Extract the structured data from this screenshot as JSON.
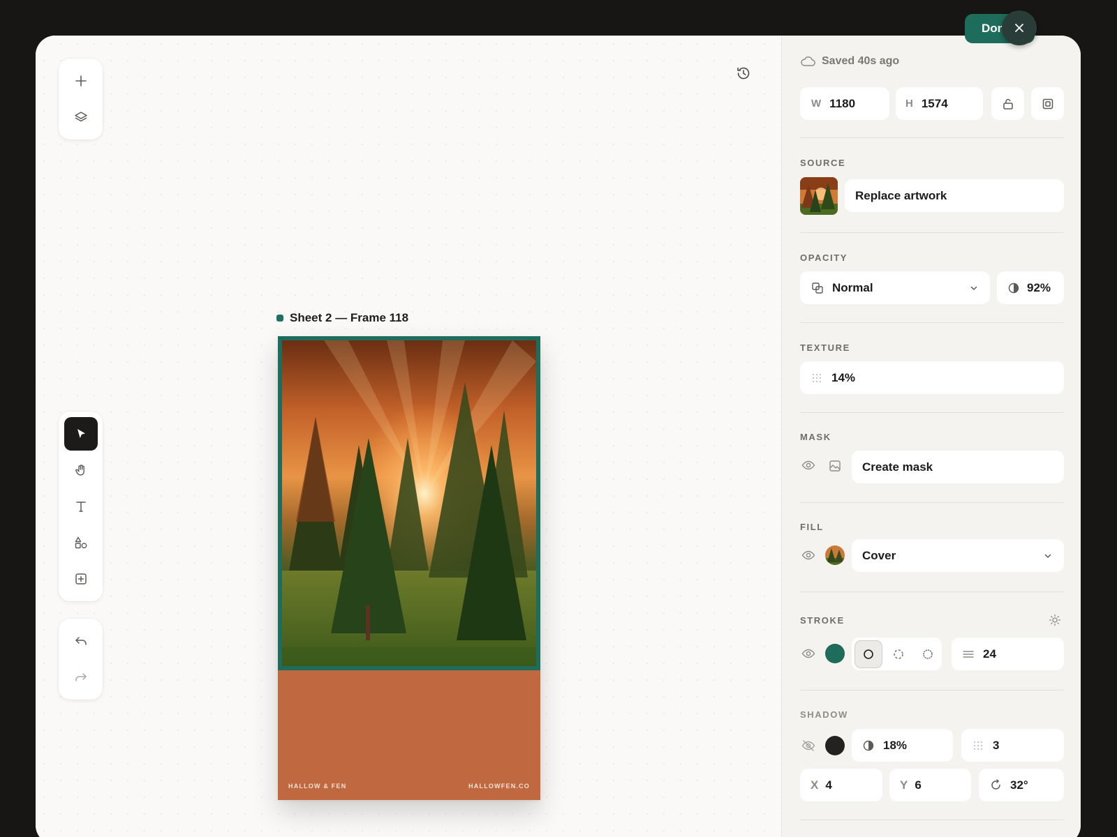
{
  "canvas": {
    "frame_label": "Sheet 2 — Frame 118",
    "poster": {
      "brand_left": "HALLOW & FEN",
      "brand_right": "HALLOWFEN.CO",
      "border_color": "#1e6c5c",
      "footer_color": "#c0683f"
    },
    "toolbar_top": [
      {
        "name": "add",
        "icon": "plus-icon"
      },
      {
        "name": "layers",
        "icon": "layers-icon"
      }
    ],
    "toolbar_tools": [
      {
        "name": "select",
        "icon": "pointer-icon",
        "active": true
      },
      {
        "name": "hand",
        "icon": "hand-icon"
      },
      {
        "name": "text",
        "icon": "text-icon"
      },
      {
        "name": "shapes",
        "icon": "shapes-icon"
      },
      {
        "name": "insert",
        "icon": "plus-square-icon"
      }
    ],
    "toolbar_history": [
      {
        "name": "undo",
        "icon": "undo-icon"
      },
      {
        "name": "redo",
        "icon": "redo-icon",
        "disabled": true
      }
    ]
  },
  "panel": {
    "status": "Saved 40s ago",
    "done_label": "Done",
    "size": {
      "w_label": "W",
      "w_value": "1180",
      "h_label": "H",
      "h_value": "1574"
    },
    "source": {
      "title": "SOURCE",
      "replace_label": "Replace artwork"
    },
    "opacity": {
      "title": "OPACITY",
      "blend_mode": "Normal",
      "value": "92%"
    },
    "texture": {
      "title": "TEXTURE",
      "value": "14%"
    },
    "mask": {
      "title": "MASK",
      "create_label": "Create mask"
    },
    "fill": {
      "title": "FILL",
      "mode": "Cover"
    },
    "stroke": {
      "title": "STROKE",
      "color": "#1e6c5c",
      "width": "24",
      "selected_style": "solid"
    },
    "shadow": {
      "title": "SHADOW",
      "color": "#232221",
      "opacity": "18%",
      "blur": "3",
      "x_label": "X",
      "x_value": "4",
      "y_label": "Y",
      "y_value": "6",
      "angle": "32°"
    }
  }
}
